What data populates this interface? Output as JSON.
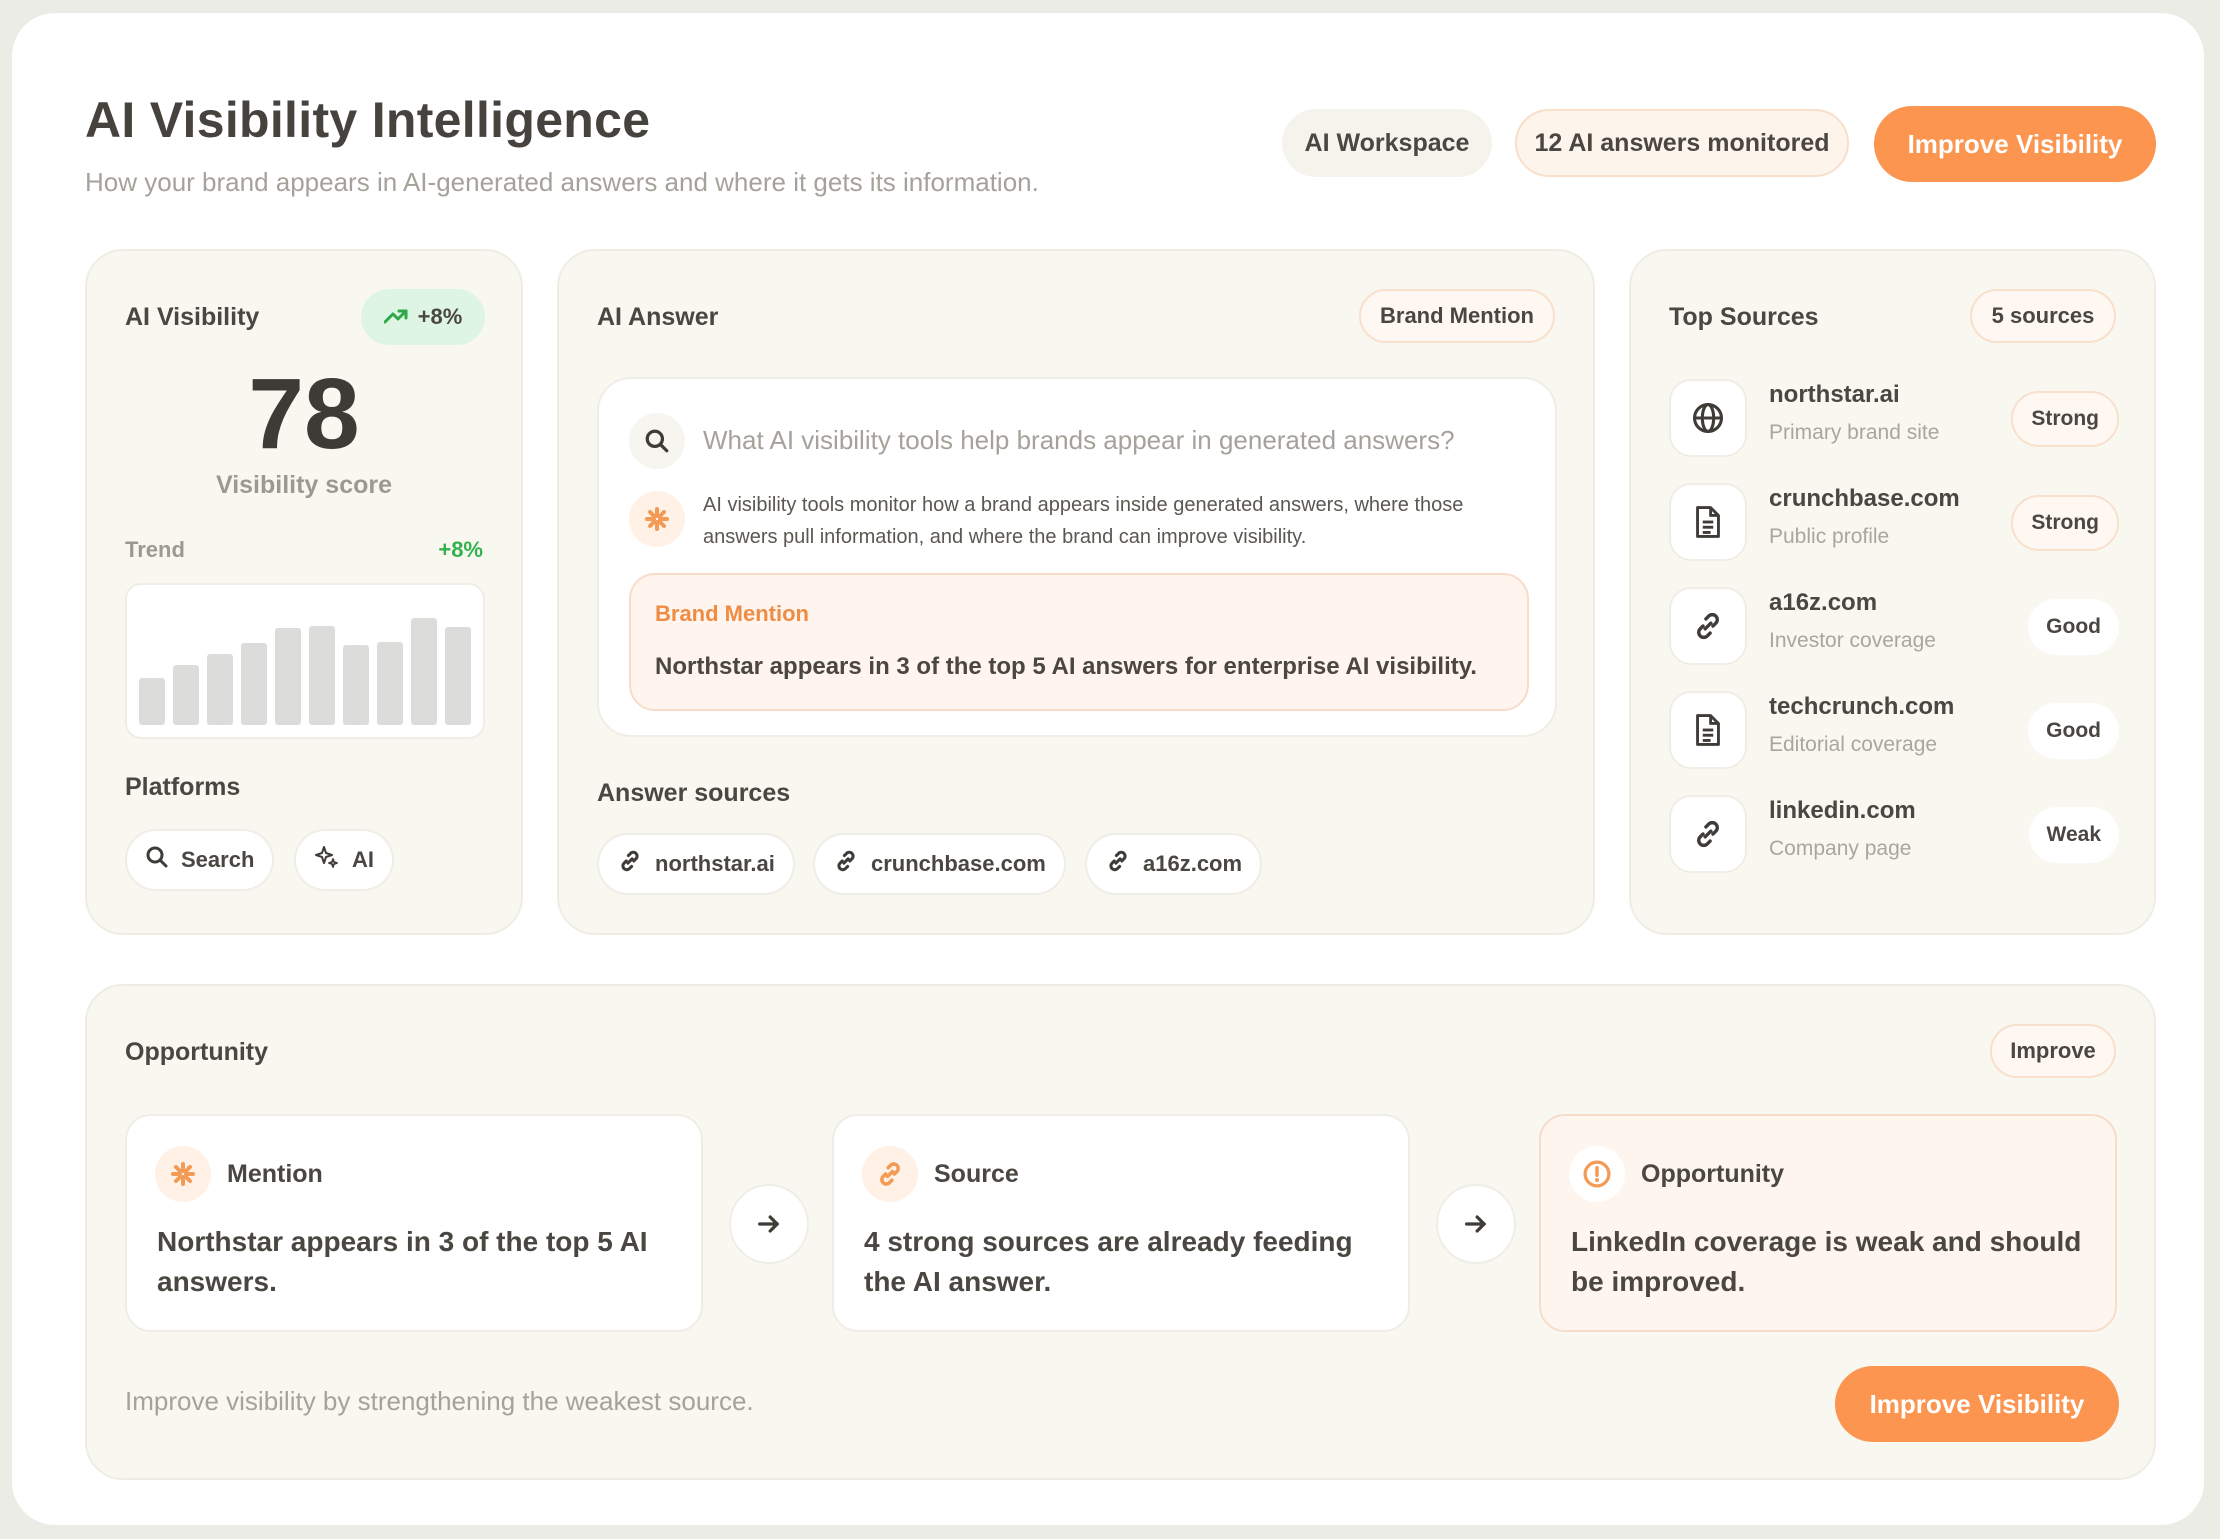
{
  "header": {
    "title": "AI Visibility Intelligence",
    "subtitle": "How your brand appears in AI-generated answers and where it gets its information.",
    "workspace": "AI Workspace",
    "monitored": "12 AI answers monitored",
    "cta": "Improve Visibility"
  },
  "visibility": {
    "label": "AI Visibility",
    "delta": "+8%",
    "score": "78",
    "score_label": "Visibility score",
    "trend_label": "Trend",
    "trend_delta": "+8%",
    "trend_values": [
      0.47,
      0.6,
      0.71,
      0.83,
      0.98,
      1.0,
      0.81,
      0.84,
      1.08,
      0.99
    ],
    "platforms_label": "Platforms",
    "platforms": [
      {
        "label": "Search",
        "icon": "search-icon"
      },
      {
        "label": "AI",
        "icon": "sparkle-icon"
      }
    ]
  },
  "answer": {
    "label": "AI Answer",
    "tag": "Brand Mention",
    "question": "What AI visibility tools help brands appear in generated answers?",
    "response": "AI visibility tools monitor how a brand appears inside generated answers, where those answers pull information, and where the brand can improve visibility.",
    "mention_title": "Brand Mention",
    "mention_text": "Northstar appears in 3 of the top 5 AI answers for enterprise AI visibility.",
    "sources_label": "Answer sources",
    "sources": [
      "northstar.ai",
      "crunchbase.com",
      "a16z.com"
    ]
  },
  "top_sources": {
    "label": "Top Sources",
    "count": "5 sources",
    "items": [
      {
        "name": "northstar.ai",
        "desc": "Primary brand site",
        "strength": "Strong",
        "icon": "globe-icon"
      },
      {
        "name": "crunchbase.com",
        "desc": "Public profile",
        "strength": "Strong",
        "icon": "document-icon"
      },
      {
        "name": "a16z.com",
        "desc": "Investor coverage",
        "strength": "Good",
        "icon": "link-icon"
      },
      {
        "name": "techcrunch.com",
        "desc": "Editorial coverage",
        "strength": "Good",
        "icon": "document-icon"
      },
      {
        "name": "linkedin.com",
        "desc": "Company page",
        "strength": "Weak",
        "icon": "link-icon"
      }
    ]
  },
  "opportunity": {
    "label": "Opportunity",
    "tag": "Improve",
    "steps": [
      {
        "title": "Mention",
        "text": "Northstar appears in 3 of the top 5 AI answers.",
        "icon": "sparkle-icon"
      },
      {
        "title": "Source",
        "text": "4 strong sources are already feeding the AI answer.",
        "icon": "link-icon"
      },
      {
        "title": "Opportunity",
        "text": "LinkedIn coverage is weak and should be improved.",
        "icon": "alert-icon"
      }
    ],
    "footer": "Improve visibility by strengthening the weakest source.",
    "cta": "Improve Visibility"
  },
  "colors": {
    "accent": "#fb9550",
    "positive": "#34b04f",
    "card_bg": "#f8f7f0"
  }
}
